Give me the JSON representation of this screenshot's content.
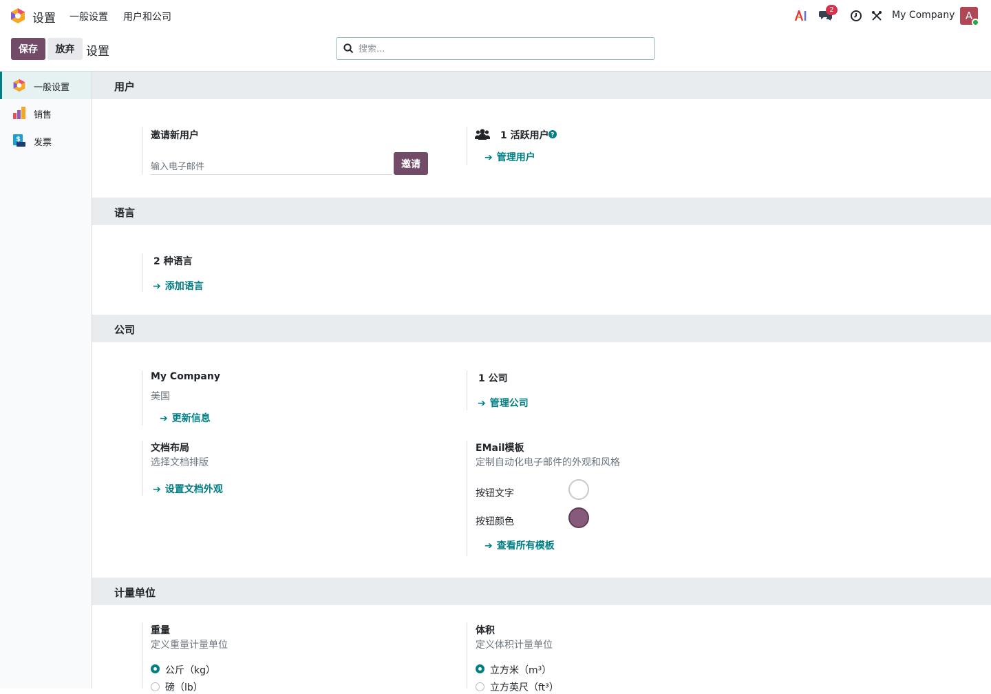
{
  "navbar": {
    "app_name": "设置",
    "menus": [
      "一般设置",
      "用户和公司"
    ],
    "ai_icon": "ai-icon",
    "messages_badge": "2",
    "company": "My Company",
    "avatar_letter": "A"
  },
  "control_panel": {
    "save_label": "保存",
    "discard_label": "放弃",
    "breadcrumb": "设置",
    "search_placeholder": "搜索..."
  },
  "sidebar": {
    "items": [
      {
        "label": "一般设置",
        "icon": "settings-app-icon",
        "active": true
      },
      {
        "label": "销售",
        "icon": "sales-app-icon",
        "active": false
      },
      {
        "label": "发票",
        "icon": "invoicing-app-icon",
        "active": false
      }
    ]
  },
  "users": {
    "title": "用户",
    "invite_title": "邀请新用户",
    "email_placeholder": "输入电子邮件",
    "invite_label": "邀请",
    "active_users": "1 活跃用户",
    "manage_users": "管理用户"
  },
  "languages": {
    "title": "语言",
    "count": "2 种语言",
    "add_language": "添加语言"
  },
  "company": {
    "title": "公司",
    "name": "My Company",
    "country": "美国",
    "update_info": "更新信息",
    "company_count": "1 公司",
    "manage_companies": "管理公司",
    "doc_layout_title": "文档布局",
    "doc_layout_desc": "选择文档排版",
    "doc_layout_link": "设置文档外观",
    "email_title": "EMail模板",
    "email_desc": "定制自动化电子邮件的外观和风格",
    "button_text_label": "按钮文字",
    "button_color_label": "按钮颜色",
    "button_text_color": "#ffffff",
    "button_color": "#875a7b",
    "view_templates": "查看所有模板"
  },
  "uom": {
    "title": "计量单位",
    "weight_title": "重量",
    "weight_desc": "定义重量计量单位",
    "weight_options": [
      "公斤（kg）",
      "磅（lb）"
    ],
    "volume_title": "体积",
    "volume_desc": "定义体积计量单位",
    "volume_options": [
      "立方米（m³）",
      "立方英尺（ft³）"
    ]
  },
  "colors": {
    "brand": "#714b67",
    "accent": "#017e84"
  }
}
